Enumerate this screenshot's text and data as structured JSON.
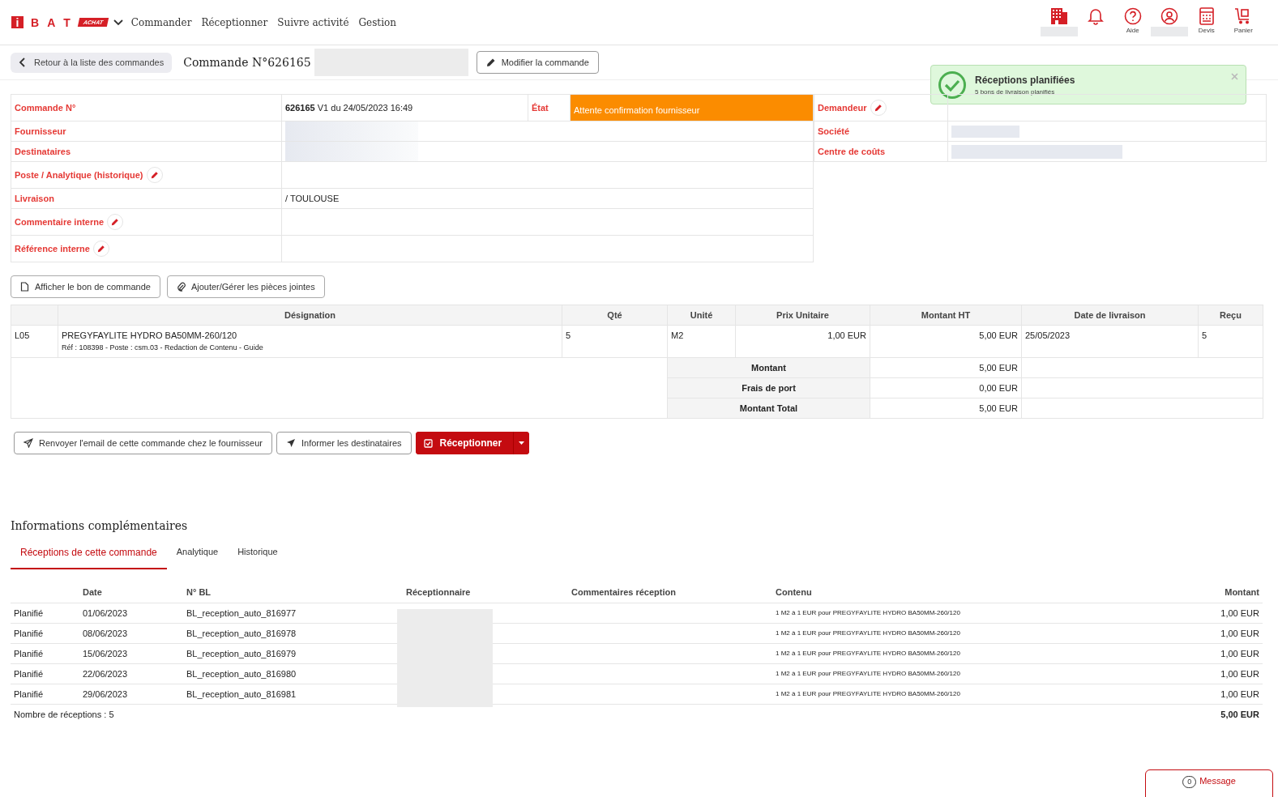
{
  "nav": {
    "logo_letters": [
      "i",
      "B",
      "A",
      "T"
    ],
    "logo_badge": "ACHAT",
    "menu": [
      "Commander",
      "Réceptionner",
      "Suivre activité",
      "Gestion"
    ],
    "icons": [
      {
        "kind": "building",
        "redacted": true
      },
      {
        "kind": "bell",
        "redacted": false
      },
      {
        "kind": "help",
        "label": "Aide",
        "redacted": false
      },
      {
        "kind": "user",
        "redacted": true
      },
      {
        "kind": "calculator",
        "label": "Devis",
        "redacted": false
      },
      {
        "kind": "cart",
        "label": "Panier",
        "redacted": false
      }
    ]
  },
  "header": {
    "back": "Retour à la liste des commandes",
    "title": "Commande N°626165",
    "modify": "Modifier la commande"
  },
  "toast": {
    "title": "Réceptions planifiées",
    "message": "5 bons de livraison planifiés"
  },
  "order_info": {
    "number_label": "Commande N°",
    "number_value": "**626165** V1 du 24/05/2023 16:49",
    "state_label": "État",
    "state_value": "Attente confirmation fournisseur",
    "rows": [
      {
        "label": "Fournisseur",
        "value": "",
        "redacted": true,
        "editable": false
      },
      {
        "label": "Destinataires",
        "value": "",
        "redacted": true,
        "editable": false
      },
      {
        "label": "Poste / Analytique (historique)",
        "value": "",
        "redacted": false,
        "editable": true
      },
      {
        "label": "Livraison",
        "value": "/ TOULOUSE",
        "redacted": false,
        "editable": false
      },
      {
        "label": "Commentaire interne",
        "value": "",
        "redacted": false,
        "editable": true
      },
      {
        "label": "Référence interne",
        "value": "",
        "redacted": false,
        "editable": true
      }
    ],
    "side_rows": [
      {
        "label": "Demandeur",
        "redacted": false,
        "editable": true
      },
      {
        "label": "Société",
        "redacted": true,
        "editable": false
      },
      {
        "label": "Centre de coûts",
        "redacted": true,
        "editable": false
      }
    ]
  },
  "doc_buttons": [
    {
      "kind": "file",
      "label": "Afficher le bon de commande"
    },
    {
      "kind": "clip",
      "label": "Ajouter/Gérer les pièces jointes"
    }
  ],
  "lines_table": {
    "columns": [
      "Désignation",
      "Qté",
      "Unité",
      "Prix Unitaire",
      "Montant HT",
      "Date de livraison",
      "Reçu"
    ],
    "rows": [
      {
        "line": "L05",
        "designation": "PREGYFAYLITE HYDRO BA50MM-260/120",
        "detail": "Réf : 108398 - Poste : csm.03 - Redaction de Contenu - Guide",
        "qty": "5",
        "unit": "M2",
        "unit_price": "1,00 EUR",
        "amount": "5,00 EUR",
        "delivery_date": "25/05/2023",
        "received": "5"
      }
    ],
    "totals": [
      {
        "label": "Montant",
        "value": "5,00 EUR"
      },
      {
        "label": "Frais de port",
        "value": "0,00 EUR"
      },
      {
        "label": "Montant Total",
        "value": "5,00 EUR"
      }
    ]
  },
  "actions": [
    {
      "kind": "plane-outline",
      "label": "Renvoyer l'email de cette commande chez le fournisseur"
    },
    {
      "kind": "plane",
      "label": "Informer les destinataires"
    },
    {
      "kind": "primary",
      "label": "Réceptionner"
    }
  ],
  "section_title": "Informations complémentaires",
  "tabs": [
    {
      "label": "Réceptions de cette commande",
      "selected": true
    },
    {
      "label": "Analytique",
      "selected": false
    },
    {
      "label": "Historique",
      "selected": false
    }
  ],
  "receptions": {
    "columns": [
      "Date",
      "N° BL",
      "Réceptionnaire",
      "Commentaires réception",
      "Contenu",
      "Montant"
    ],
    "rows": [
      {
        "status": "Planifié",
        "date": "01/06/2023",
        "bl": "BL_reception_auto_816977",
        "content": "1 M2 à 1 EUR pour PREGYFAYLITE HYDRO BA50MM-260/120",
        "amount": "1,00 EUR"
      },
      {
        "status": "Planifié",
        "date": "08/06/2023",
        "bl": "BL_reception_auto_816978",
        "content": "1 M2 à 1 EUR pour PREGYFAYLITE HYDRO BA50MM-260/120",
        "amount": "1,00 EUR"
      },
      {
        "status": "Planifié",
        "date": "15/06/2023",
        "bl": "BL_reception_auto_816979",
        "content": "1 M2 à 1 EUR pour PREGYFAYLITE HYDRO BA50MM-260/120",
        "amount": "1,00 EUR"
      },
      {
        "status": "Planifié",
        "date": "22/06/2023",
        "bl": "BL_reception_auto_816980",
        "content": "1 M2 à 1 EUR pour PREGYFAYLITE HYDRO BA50MM-260/120",
        "amount": "1,00 EUR"
      },
      {
        "status": "Planifié",
        "date": "29/06/2023",
        "bl": "BL_reception_auto_816981",
        "content": "1 M2 à 1 EUR pour PREGYFAYLITE HYDRO BA50MM-260/120",
        "amount": "1,00 EUR"
      }
    ],
    "count": "Nombre de réceptions : 5",
    "total": "5,00 EUR"
  },
  "message_button": {
    "count": "0",
    "label": "Message"
  }
}
